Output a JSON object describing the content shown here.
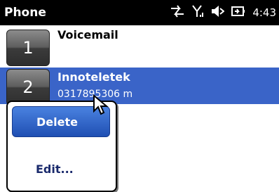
{
  "titlebar": {
    "title": "Phone",
    "time": "4:43",
    "icons": [
      "data-transfer-icon",
      "signal-icon",
      "volume-icon",
      "battery-charging-icon"
    ]
  },
  "speed_dial": [
    {
      "key": "1",
      "name": "Voicemail",
      "detail": ""
    },
    {
      "key": "2",
      "name": "Innoteletek",
      "detail": "0317895306 m"
    }
  ],
  "context_menu": {
    "items": [
      "Delete",
      "Edit..."
    ]
  },
  "colors": {
    "titlebar": "#000000",
    "selection": "#3a64c8",
    "menu_highlight": "#2a5cc8",
    "menu_text": "#1a2a6c"
  }
}
